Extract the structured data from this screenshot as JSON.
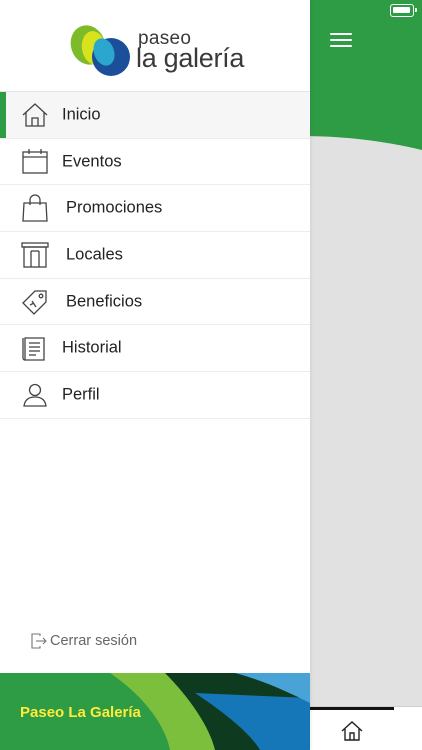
{
  "app": {
    "brand_small": "paseo",
    "brand_large": "la galería",
    "footer_title": "Paseo La Galería"
  },
  "menu": {
    "items": [
      {
        "label": "Inicio",
        "icon": "home-icon",
        "active": true
      },
      {
        "label": "Eventos",
        "icon": "calendar-icon",
        "active": false
      },
      {
        "label": "Promociones",
        "icon": "shopping-bag-icon",
        "active": false
      },
      {
        "label": "Locales",
        "icon": "store-icon",
        "active": false
      },
      {
        "label": "Beneficios",
        "icon": "tag-icon",
        "active": false
      },
      {
        "label": "Historial",
        "icon": "history-list-icon",
        "active": false
      },
      {
        "label": "Perfil",
        "icon": "profile-icon",
        "active": false
      }
    ],
    "logout_label": "Cerrar sesión"
  },
  "colors": {
    "brand_green": "#2e9b45",
    "footer_text": "#ffeb3b",
    "bg_gray": "#e1e1e1"
  }
}
